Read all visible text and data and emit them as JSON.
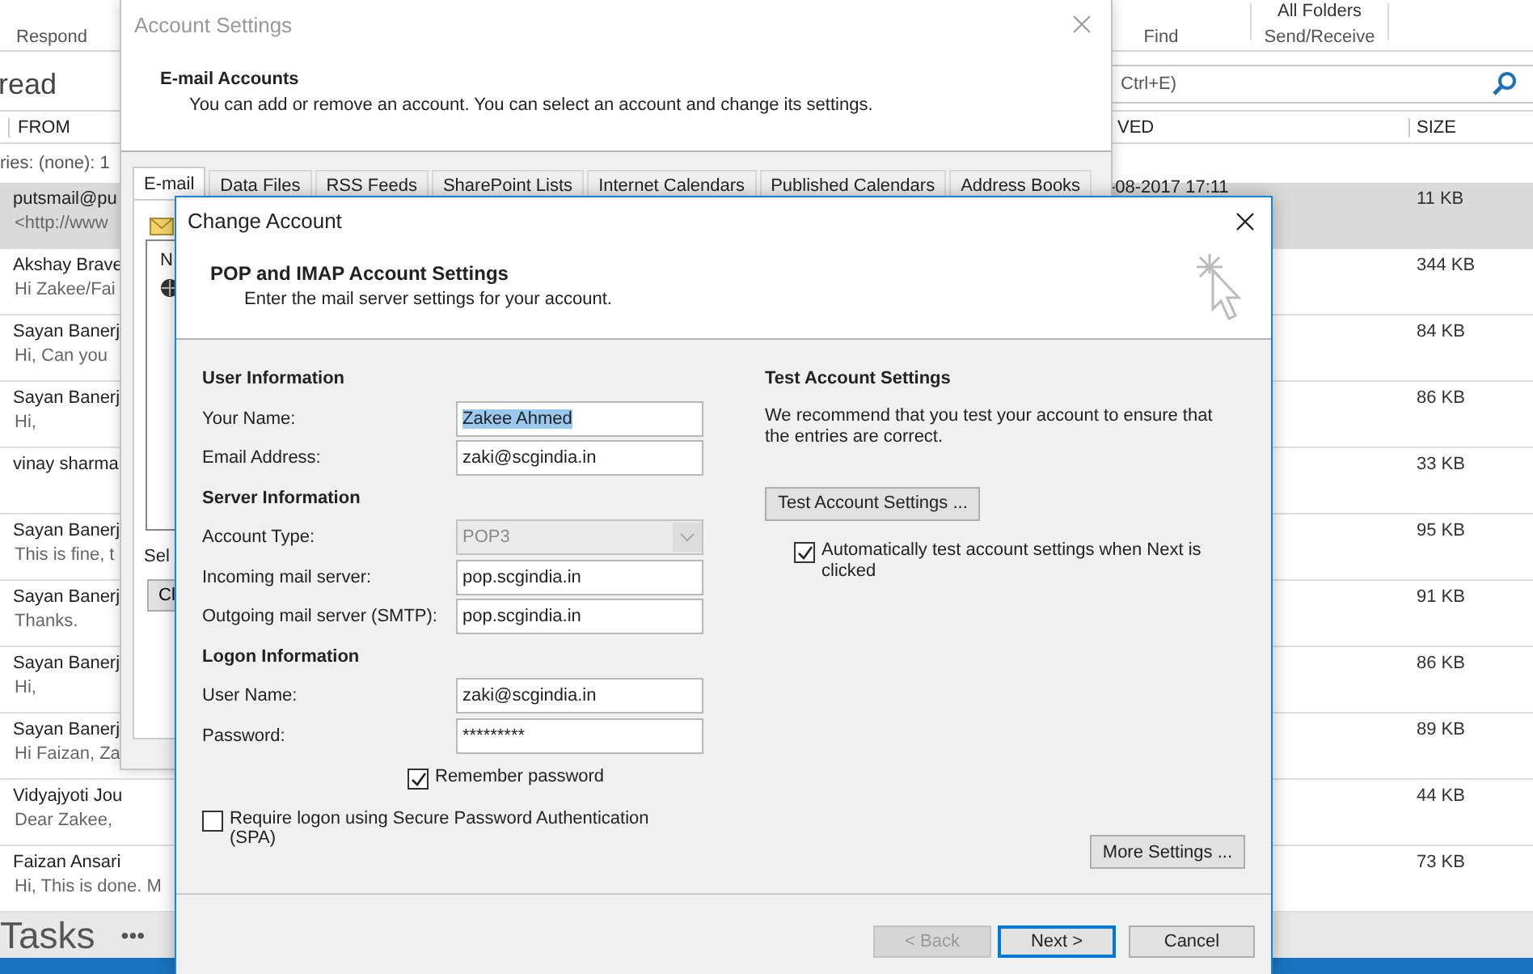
{
  "ribbon": {
    "respond": "Respond",
    "find": "Find",
    "all_folders": "All Folders",
    "send_receive": "Send/Receive"
  },
  "view_title": "read",
  "search": {
    "placeholder": "Ctrl+E)"
  },
  "columns": {
    "from": "FROM",
    "received": "VED",
    "size": "SIZE"
  },
  "filter_text": "ries: (none): 1",
  "messages": [
    {
      "sender": "putsmail@pu",
      "preview": "<http://www",
      "received": "-08-2017 17:11",
      "size": "11 KB",
      "selected": true
    },
    {
      "sender": "Akshay Brave",
      "preview": "Hi Zakee/Fai",
      "size": "344 KB",
      "selected": false
    },
    {
      "sender": "Sayan Banerj",
      "preview": "Hi,  Can you",
      "size": "84 KB",
      "selected": false
    },
    {
      "sender": "Sayan Banerj",
      "preview": "Hi,",
      "size": "86 KB",
      "selected": false
    },
    {
      "sender": "vinay sharma",
      "size": "33 KB",
      "selected": false
    },
    {
      "sender": "Sayan Banerj",
      "preview": "This is fine, t",
      "size": "95 KB",
      "selected": false
    },
    {
      "sender": "Sayan Banerj",
      "preview": "Thanks.",
      "size": "91 KB",
      "selected": false
    },
    {
      "sender": "Sayan Banerj",
      "preview": "Hi,",
      "size": "86 KB",
      "selected": false
    },
    {
      "sender": "Sayan Banerj",
      "preview": "Hi Faizan, Za",
      "size": "89 KB",
      "selected": false
    },
    {
      "sender": "Vidyajyoti Jou",
      "preview": "Dear Zakee,",
      "size": "44 KB",
      "selected": false
    },
    {
      "sender": "Faizan Ansari",
      "preview": "Hi,  This is done.  M",
      "size": "73 KB",
      "selected": false
    }
  ],
  "bottom_nav": {
    "label": "Tasks",
    "more": "•••"
  },
  "account_settings": {
    "title": "Account Settings",
    "heading": "E-mail Accounts",
    "description": "You can add or remove an account. You can select an account and change its settings.",
    "tabs": [
      {
        "label": "E-mail",
        "selected": true
      },
      {
        "label": "Data Files",
        "selected": false
      },
      {
        "label": "RSS Feeds",
        "selected": false
      },
      {
        "label": "SharePoint Lists",
        "selected": false
      },
      {
        "label": "Internet Calendars",
        "selected": false
      },
      {
        "label": "Published Calendars",
        "selected": false
      },
      {
        "label": "Address Books",
        "selected": false
      }
    ],
    "list_header": "N",
    "select_label": "Sel",
    "button": "Cl"
  },
  "change_account": {
    "title": "Change Account",
    "heading": "POP and IMAP Account Settings",
    "subheading": "Enter the mail server settings for your account.",
    "sections": [
      {
        "title": "User Information",
        "fields": [
          {
            "label": "Your Name:",
            "value": "Zakee Ahmed",
            "kind": "text",
            "text_selected": true
          },
          {
            "label": "Email Address:",
            "value": "zaki@scgindia.in",
            "kind": "text",
            "text_selected": false
          }
        ]
      },
      {
        "title": "Server Information",
        "fields": [
          {
            "label": "Account Type:",
            "value": "POP3",
            "kind": "select",
            "disabled": true
          },
          {
            "label": "Incoming mail server:",
            "value": "pop.scgindia.in",
            "kind": "text",
            "text_selected": false
          },
          {
            "label": "Outgoing mail server (SMTP):",
            "value": "pop.scgindia.in",
            "kind": "text",
            "text_selected": false
          }
        ]
      },
      {
        "title": "Logon Information",
        "fields": [
          {
            "label": "User Name:",
            "value": "zaki@scgindia.in",
            "kind": "text",
            "text_selected": false
          },
          {
            "label": "Password:",
            "value": "*********",
            "kind": "text",
            "text_selected": false
          }
        ]
      }
    ],
    "remember_password": {
      "label": "Remember password",
      "checked": true
    },
    "spa": {
      "label": "Require logon using Secure Password Authentication (SPA)",
      "checked": false
    },
    "test": {
      "title": "Test Account Settings",
      "description": "We recommend that you test your account to ensure that the entries are correct.",
      "button": "Test Account Settings ...",
      "auto_test": {
        "label": "Automatically test account settings when Next is clicked",
        "checked": true
      }
    },
    "more_settings": "More Settings ...",
    "buttons": [
      {
        "label": "< Back",
        "disabled": true,
        "default": false
      },
      {
        "label": "Next >",
        "disabled": false,
        "default": true
      },
      {
        "label": "Cancel",
        "disabled": false,
        "default": false
      }
    ]
  }
}
